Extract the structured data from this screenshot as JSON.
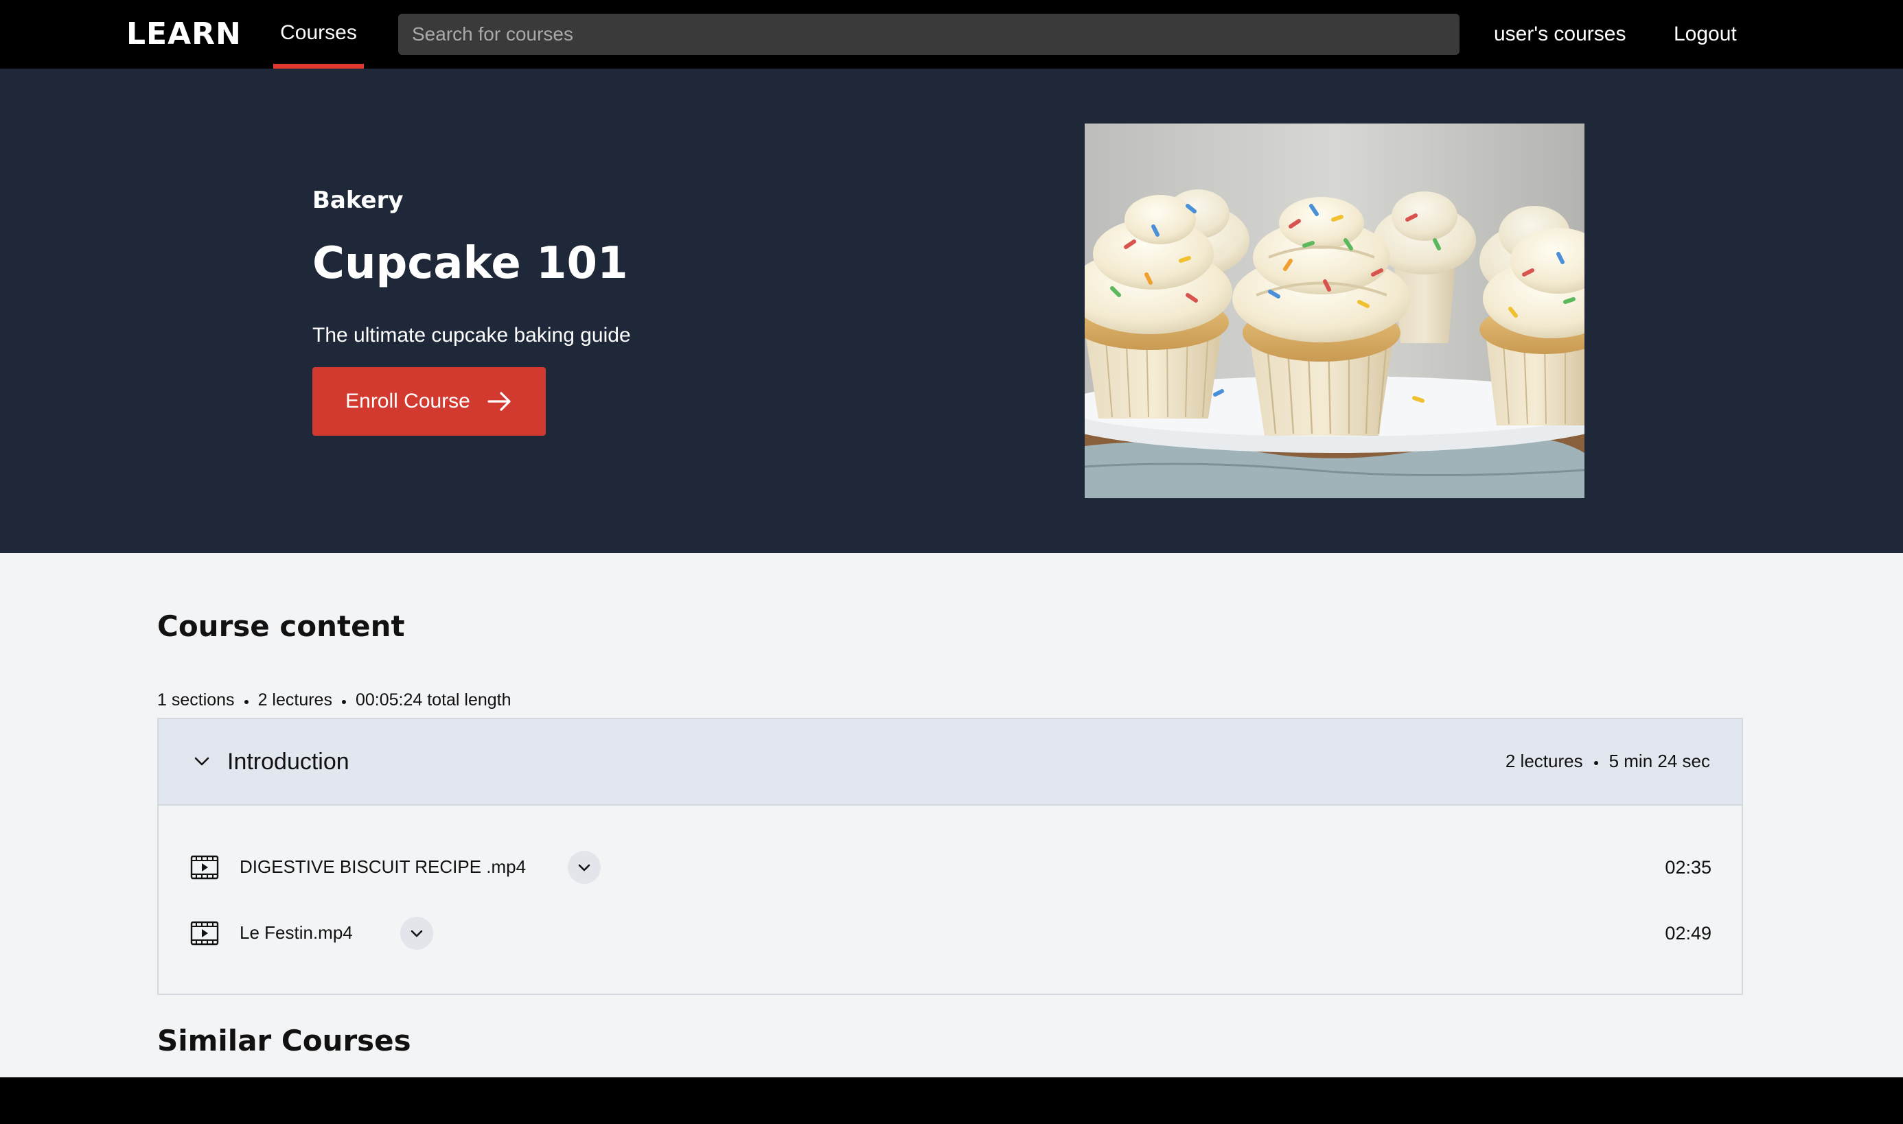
{
  "nav": {
    "logo": "LEARN",
    "courses_label": "Courses",
    "search_placeholder": "Search for courses",
    "user_courses_label": "user's courses",
    "logout_label": "Logout"
  },
  "hero": {
    "category": "Bakery",
    "title": "Cupcake 101",
    "subtitle": "The ultimate cupcake baking guide",
    "enroll_label": "Enroll Course",
    "enroll_icon": "arrow-right-icon",
    "image_subject": "cupcake-photo"
  },
  "course_content": {
    "heading": "Course content",
    "stats": {
      "sections": "1 sections",
      "lectures": "2 lectures",
      "length": "00:05:24 total length"
    },
    "sections": [
      {
        "title": "Introduction",
        "lectures_count": "2 lectures",
        "duration": "5 min 24 sec",
        "expanded": true,
        "lectures": [
          {
            "title": "DIGESTIVE BISCUIT RECIPE .mp4",
            "duration": "02:35",
            "icon": "video-icon"
          },
          {
            "title": "Le Festin.mp4",
            "duration": "02:49",
            "icon": "video-icon"
          }
        ]
      }
    ]
  },
  "similar": {
    "heading": "Similar Courses"
  },
  "colors": {
    "topbar": "#000000",
    "hero_bg": "#1f2839",
    "accent": "#d23a30",
    "page_bg": "#f3f4f6",
    "section_header_bg": "#e2e7ef"
  }
}
